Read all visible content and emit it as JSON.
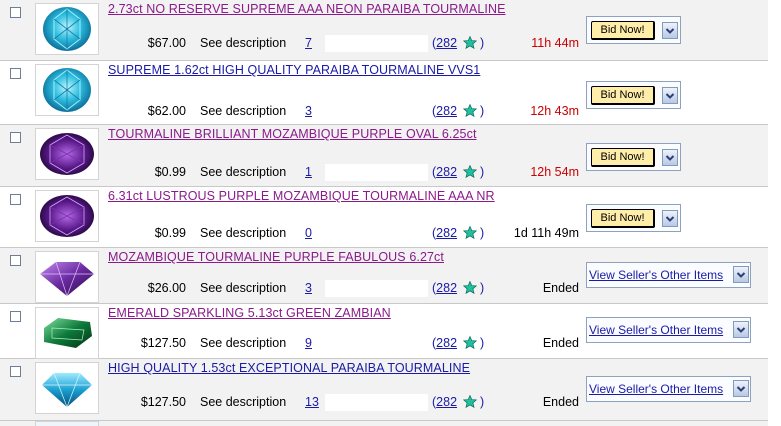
{
  "listings": [
    {
      "title": "2.73ct NO RESERVE SUPREME AAA NEON PARAIBA TOURMALINE",
      "title_style": "visited",
      "price": "$67.00",
      "description": "See description",
      "bids": "7",
      "feedback_open": "(",
      "feedback": "282",
      "time_left": "11h 44m",
      "time_color": "red",
      "action": "bid",
      "action_label": "Bid Now!",
      "gem": "blue-round"
    },
    {
      "title": "SUPREME 1.62ct HIGH QUALITY PARAIBA TOURMALINE VVS1",
      "title_style": "fresh",
      "price": "$62.00",
      "description": "See description",
      "bids": "3",
      "feedback_open": "(",
      "feedback": "282",
      "time_left": "12h 43m",
      "time_color": "red",
      "action": "bid",
      "action_label": "Bid Now!",
      "gem": "blue-round"
    },
    {
      "title": "TOURMALINE BRILLIANT MOZAMBIQUE PURPLE OVAL 6.25ct",
      "title_style": "visited",
      "price": "$0.99",
      "description": "See description",
      "bids": "1",
      "feedback_open": "(",
      "feedback": "282",
      "time_left": "12h 54m",
      "time_color": "red",
      "action": "bid",
      "action_label": "Bid Now!",
      "gem": "purple-oval"
    },
    {
      "title": "6.31ct LUSTROUS PURPLE MOZAMBIQUE TOURMALINE AAA NR",
      "title_style": "visited",
      "price": "$0.99",
      "description": "See description",
      "bids": "0",
      "feedback_open": "(",
      "feedback": "282",
      "time_left": "1d 11h 49m",
      "time_color": "black",
      "action": "bid",
      "action_label": "Bid Now!",
      "gem": "purple-oval"
    },
    {
      "title": "MOZAMBIQUE TOURMALINE PURPLE FABULOUS 6.27ct",
      "title_style": "visited",
      "price": "$26.00",
      "description": "See description",
      "bids": "3",
      "feedback_open": "(",
      "feedback": "282",
      "time_left": "Ended",
      "time_color": "black",
      "action": "seller",
      "action_label": "View Seller's Other Items",
      "gem": "purple-side"
    },
    {
      "title": "EMERALD SPARKLING 5.13ct GREEN ZAMBIAN",
      "title_style": "visited",
      "price": "$127.50",
      "description": "See description",
      "bids": "9",
      "feedback_open": "(",
      "feedback": "282",
      "time_left": "Ended",
      "time_color": "black",
      "action": "seller",
      "action_label": "View Seller's Other Items",
      "gem": "green-emerald"
    },
    {
      "title": "HIGH QUALITY 1.53ct EXCEPTIONAL PARAIBA TOURMALINE",
      "title_style": "fresh",
      "price": "$127.50",
      "description": "See description",
      "bids": "13",
      "feedback_open": "(",
      "feedback": "282",
      "time_left": "Ended",
      "time_color": "black",
      "action": "seller",
      "action_label": "View Seller's Other Items",
      "gem": "blue-side"
    }
  ],
  "colors": {
    "row_shaded": "#f2f2f2",
    "visited_link": "#8b1a8b",
    "link": "#1a1aa6",
    "time_red": "#cc0000",
    "bid_button": "#ffeeaa",
    "star": "#1fbfa0"
  },
  "icons": {
    "feedback_star": "turquoise-star-icon",
    "dropdown": "chevron-down-icon"
  }
}
